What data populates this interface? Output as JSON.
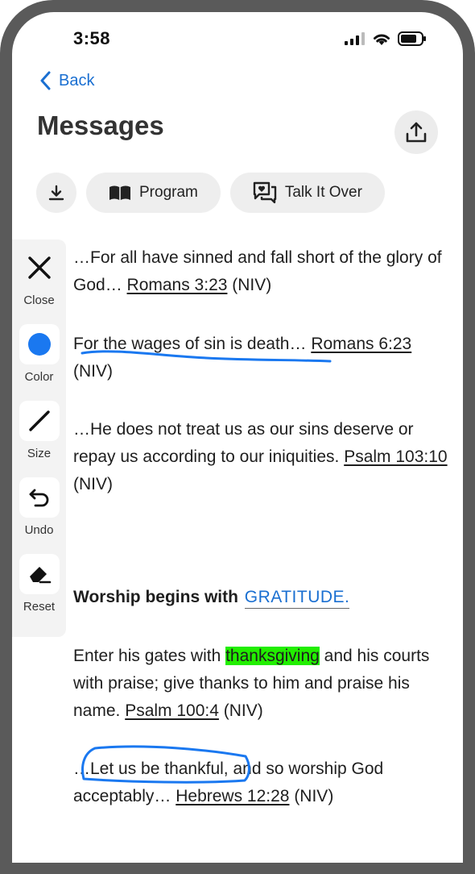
{
  "status_bar": {
    "time": "3:58"
  },
  "nav": {
    "back_label": "Back"
  },
  "header": {
    "title": "Messages"
  },
  "chips": {
    "program_label": "Program",
    "talk_label": "Talk It Over"
  },
  "toolbar": {
    "close_label": "Close",
    "color_label": "Color",
    "size_label": "Size",
    "undo_label": "Undo",
    "reset_label": "Reset",
    "selected_color": "#1a78f0"
  },
  "content": {
    "p1_text": "…For all have sinned and fall short of the glory of God… ",
    "p1_ref": "Romans 3:23",
    "p1_version": " (NIV)",
    "p2_text": "For the wages of sin is death… ",
    "p2_ref": "Romans 6:23",
    "p2_version": " (NIV)",
    "p3_text": "…He does not treat us as our sins deserve or repay us according to our iniquities. ",
    "p3_ref": "Psalm 103:10",
    "p3_version": " (NIV)",
    "heading_text": "Worship begins with ",
    "heading_link": "GRATITUDE.",
    "p4_before": "Enter his gates with ",
    "p4_highlight": "thanksgiving",
    "p4_after": " and his courts with praise; give thanks to him and praise his name. ",
    "p4_ref": "Psalm 100:4",
    "p4_version": " (NIV)",
    "p5_text": "…Let us be thankful, and so worship God acceptably… ",
    "p5_ref": "Hebrews 12:28",
    "p5_version": " (NIV)"
  },
  "colors": {
    "accent": "#1a6fd1",
    "ink": "#1a78f0",
    "highlight": "#22ee00"
  }
}
